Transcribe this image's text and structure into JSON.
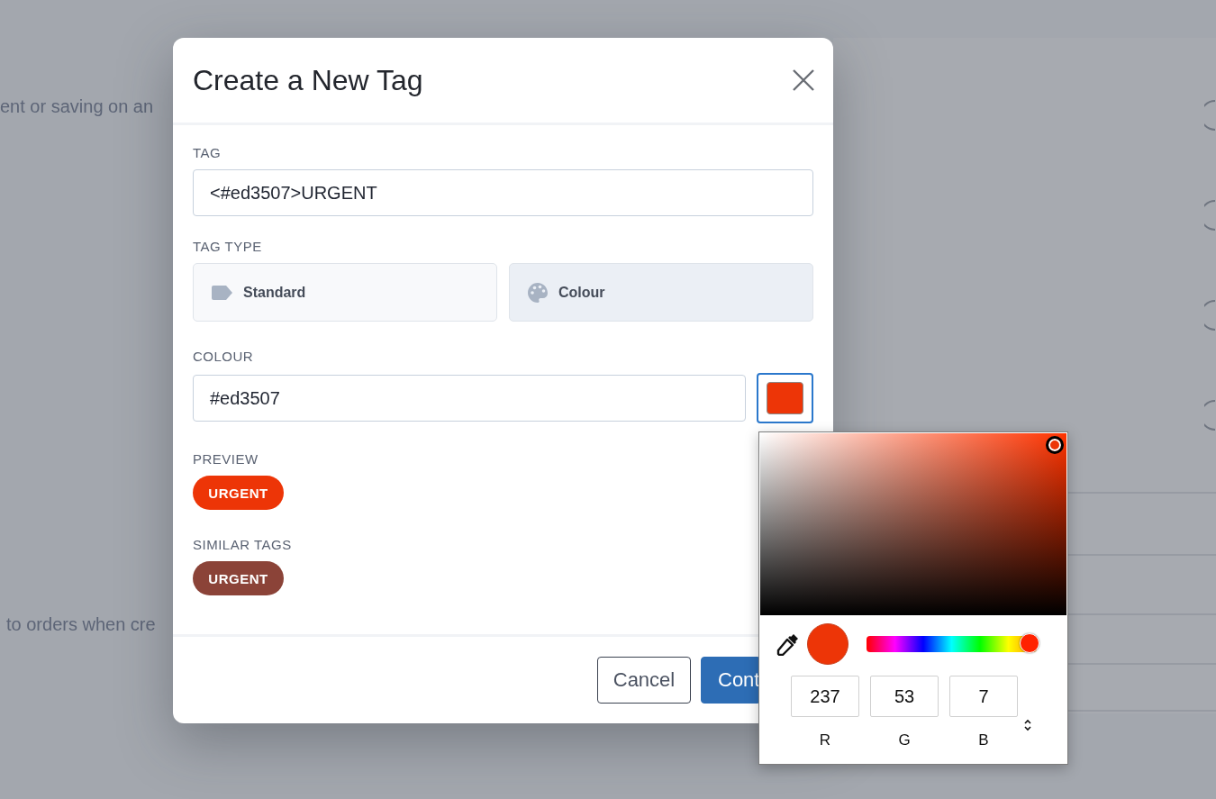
{
  "background": {
    "texts": [
      "ent or saving on an",
      "to orders when cre"
    ]
  },
  "modal": {
    "title": "Create a New Tag",
    "tag": {
      "label": "TAG",
      "value": "<#ed3507>URGENT"
    },
    "tag_type": {
      "label": "TAG TYPE",
      "options": [
        {
          "label": "Standard",
          "kind": "label",
          "selected": false
        },
        {
          "label": "Colour",
          "kind": "palette",
          "selected": true
        }
      ]
    },
    "colour": {
      "label": "COLOUR",
      "value": "#ed3507"
    },
    "preview": {
      "label": "PREVIEW",
      "tag": "URGENT"
    },
    "similar_tags": {
      "label": "SIMILAR TAGS",
      "tags": [
        {
          "label": "URGENT",
          "color": "#8b4338"
        }
      ]
    },
    "buttons": [
      {
        "label": "Cancel",
        "kind": "secondary"
      },
      {
        "label": "Cont",
        "kind": "primary"
      }
    ]
  },
  "color_picker": {
    "hue": {
      "level": 0.96
    },
    "channels": [
      {
        "value": "237",
        "label": "R"
      },
      {
        "value": "53",
        "label": "G"
      },
      {
        "value": "7",
        "label": "B"
      }
    ]
  }
}
